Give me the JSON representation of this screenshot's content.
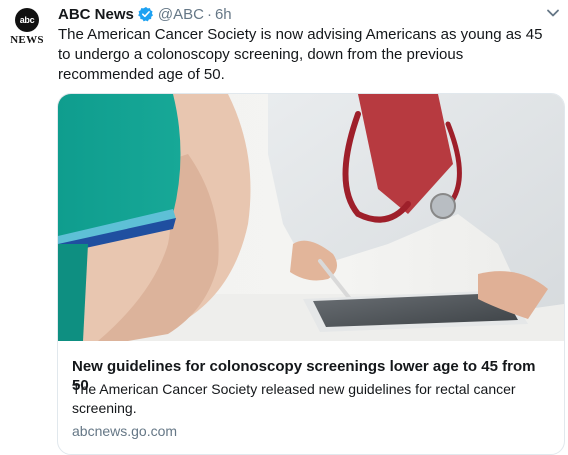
{
  "tweet": {
    "author_name": "ABC News",
    "handle": "@ABC",
    "separator": "·",
    "time": "6h",
    "text": "The American Cancer Society is now advising Americans as young as 45 to undergo a colonoscopy screening, down from the previous recommended age of 50.",
    "verified_icon": "verified-badge-icon",
    "menu_icon": "chevron-down-icon"
  },
  "avatar": {
    "logo_text": "abc",
    "wordmark": "NEWS"
  },
  "card": {
    "title": "New guidelines for colonoscopy screenings lower age to 45 from 50",
    "description": "The American Cancer Society released new guidelines for rectal cancer screening.",
    "domain": "abcnews.go.com"
  },
  "colors": {
    "verified_blue": "#1da1f2",
    "secondary_text": "#657786",
    "border": "#e1e8ed"
  }
}
